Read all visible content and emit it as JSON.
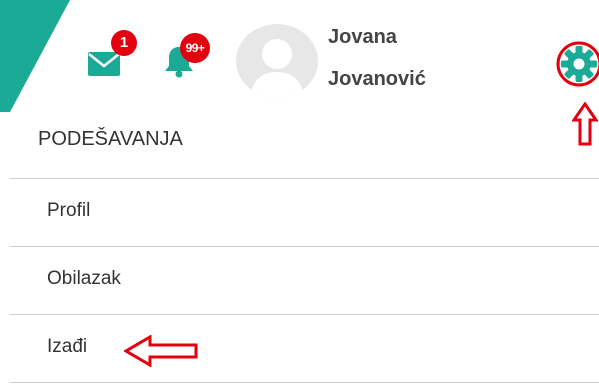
{
  "header": {
    "brand_color": "#1aaa96",
    "accent_color": "#e3000f",
    "mail_icon": "envelope-icon",
    "mail_badge": "1",
    "bell_icon": "bell-icon",
    "bell_badge": "99+",
    "avatar_icon": "user-avatar-icon",
    "user_first_name": "Jovana",
    "user_last_name": "Jovanović",
    "settings_icon": "gear-icon"
  },
  "menu": {
    "title": "PODEŠAVANJA",
    "items": [
      {
        "label": "Profil"
      },
      {
        "label": "Obilazak"
      },
      {
        "label": "Izađi"
      }
    ]
  },
  "annotations": {
    "up_arrow_icon": "arrow-up-outline-icon",
    "left_arrow_icon": "arrow-left-outline-icon"
  }
}
